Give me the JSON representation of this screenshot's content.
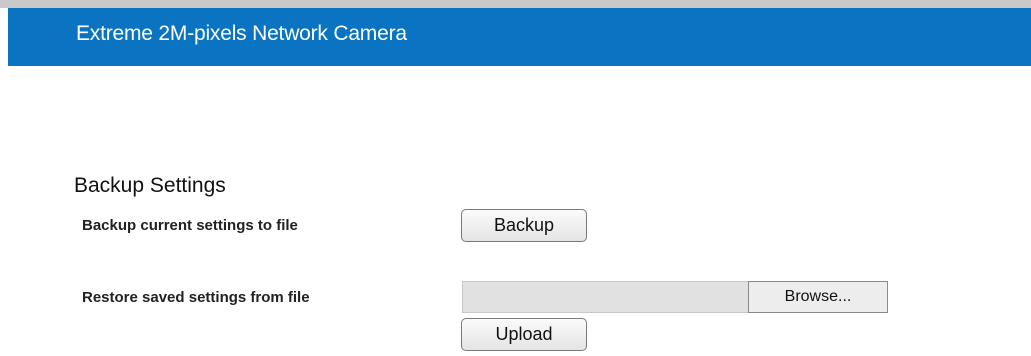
{
  "header": {
    "title": "Extreme 2M-pixels Network Camera"
  },
  "backup_section": {
    "title": "Backup Settings",
    "backup_label": "Backup current settings to file",
    "backup_button": "Backup",
    "restore_label": "Restore saved settings from file",
    "file_value": "",
    "browse_button": "Browse...",
    "upload_button": "Upload"
  },
  "colors": {
    "header_bg": "#0a73c2",
    "header_text": "#ffffff",
    "top_border": "#c9c9c9"
  }
}
